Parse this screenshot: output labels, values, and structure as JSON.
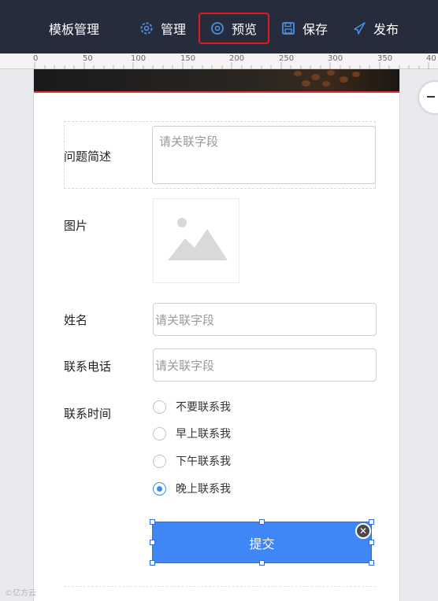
{
  "topbar": {
    "title": "模板管理",
    "manage_label": "管理",
    "preview_label": "预览",
    "save_label": "保存",
    "publish_label": "发布"
  },
  "ruler": {
    "labels": [
      "0",
      "50",
      "100",
      "150",
      "200",
      "250",
      "300",
      "350",
      "40"
    ]
  },
  "form": {
    "question_label": "问题简述",
    "question_placeholder": "请关联字段",
    "image_label": "图片",
    "name_label": "姓名",
    "name_placeholder": "请关联字段",
    "phone_label": "联系电话",
    "phone_placeholder": "请关联字段",
    "contact_time_label": "联系时间",
    "contact_options": [
      {
        "label": "不要联系我",
        "selected": false
      },
      {
        "label": "早上联系我",
        "selected": false
      },
      {
        "label": "下午联系我",
        "selected": false
      },
      {
        "label": "晚上联系我",
        "selected": true
      }
    ],
    "submit_label": "提交"
  },
  "watermark": "©亿方云",
  "colors": {
    "topbar_bg": "#262c3c",
    "highlight_border": "#e0191f",
    "submit_bg": "#3f86f6",
    "radio_selected": "#3a8ee6",
    "icon_blue": "#4a90e2"
  }
}
